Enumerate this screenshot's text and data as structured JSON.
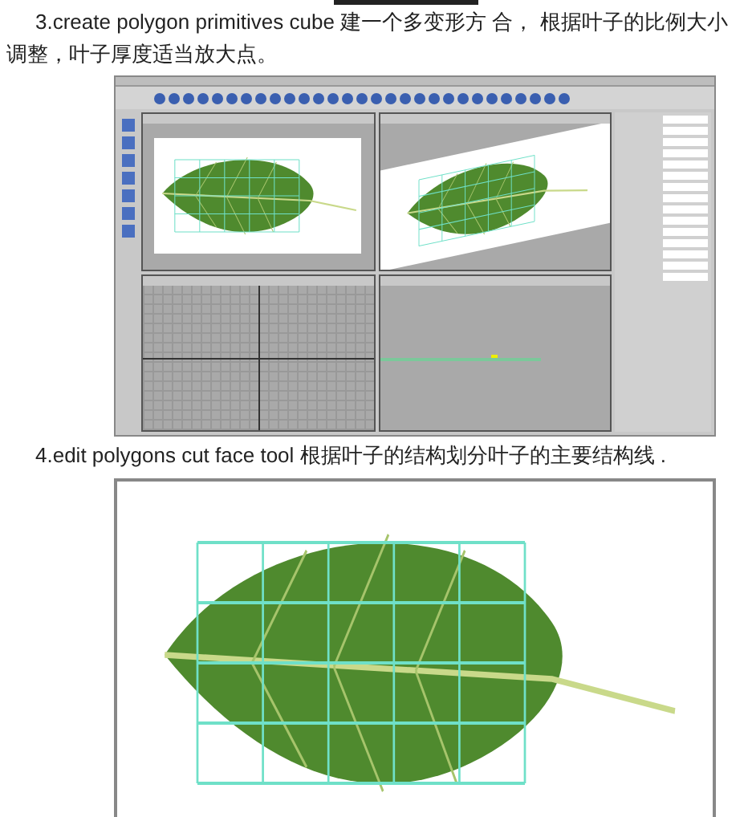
{
  "steps": [
    {
      "kind": "modeling",
      "text": "3.create polygon primitives cube 建一个多变形方 合， 根据叶子的比例大小调整，叶子厚度适当放大点。"
    },
    {
      "kind": "photo",
      "text": "4.edit polygons cut face tool 根据叶子的结构划分叶子的主要结构线 ."
    }
  ]
}
